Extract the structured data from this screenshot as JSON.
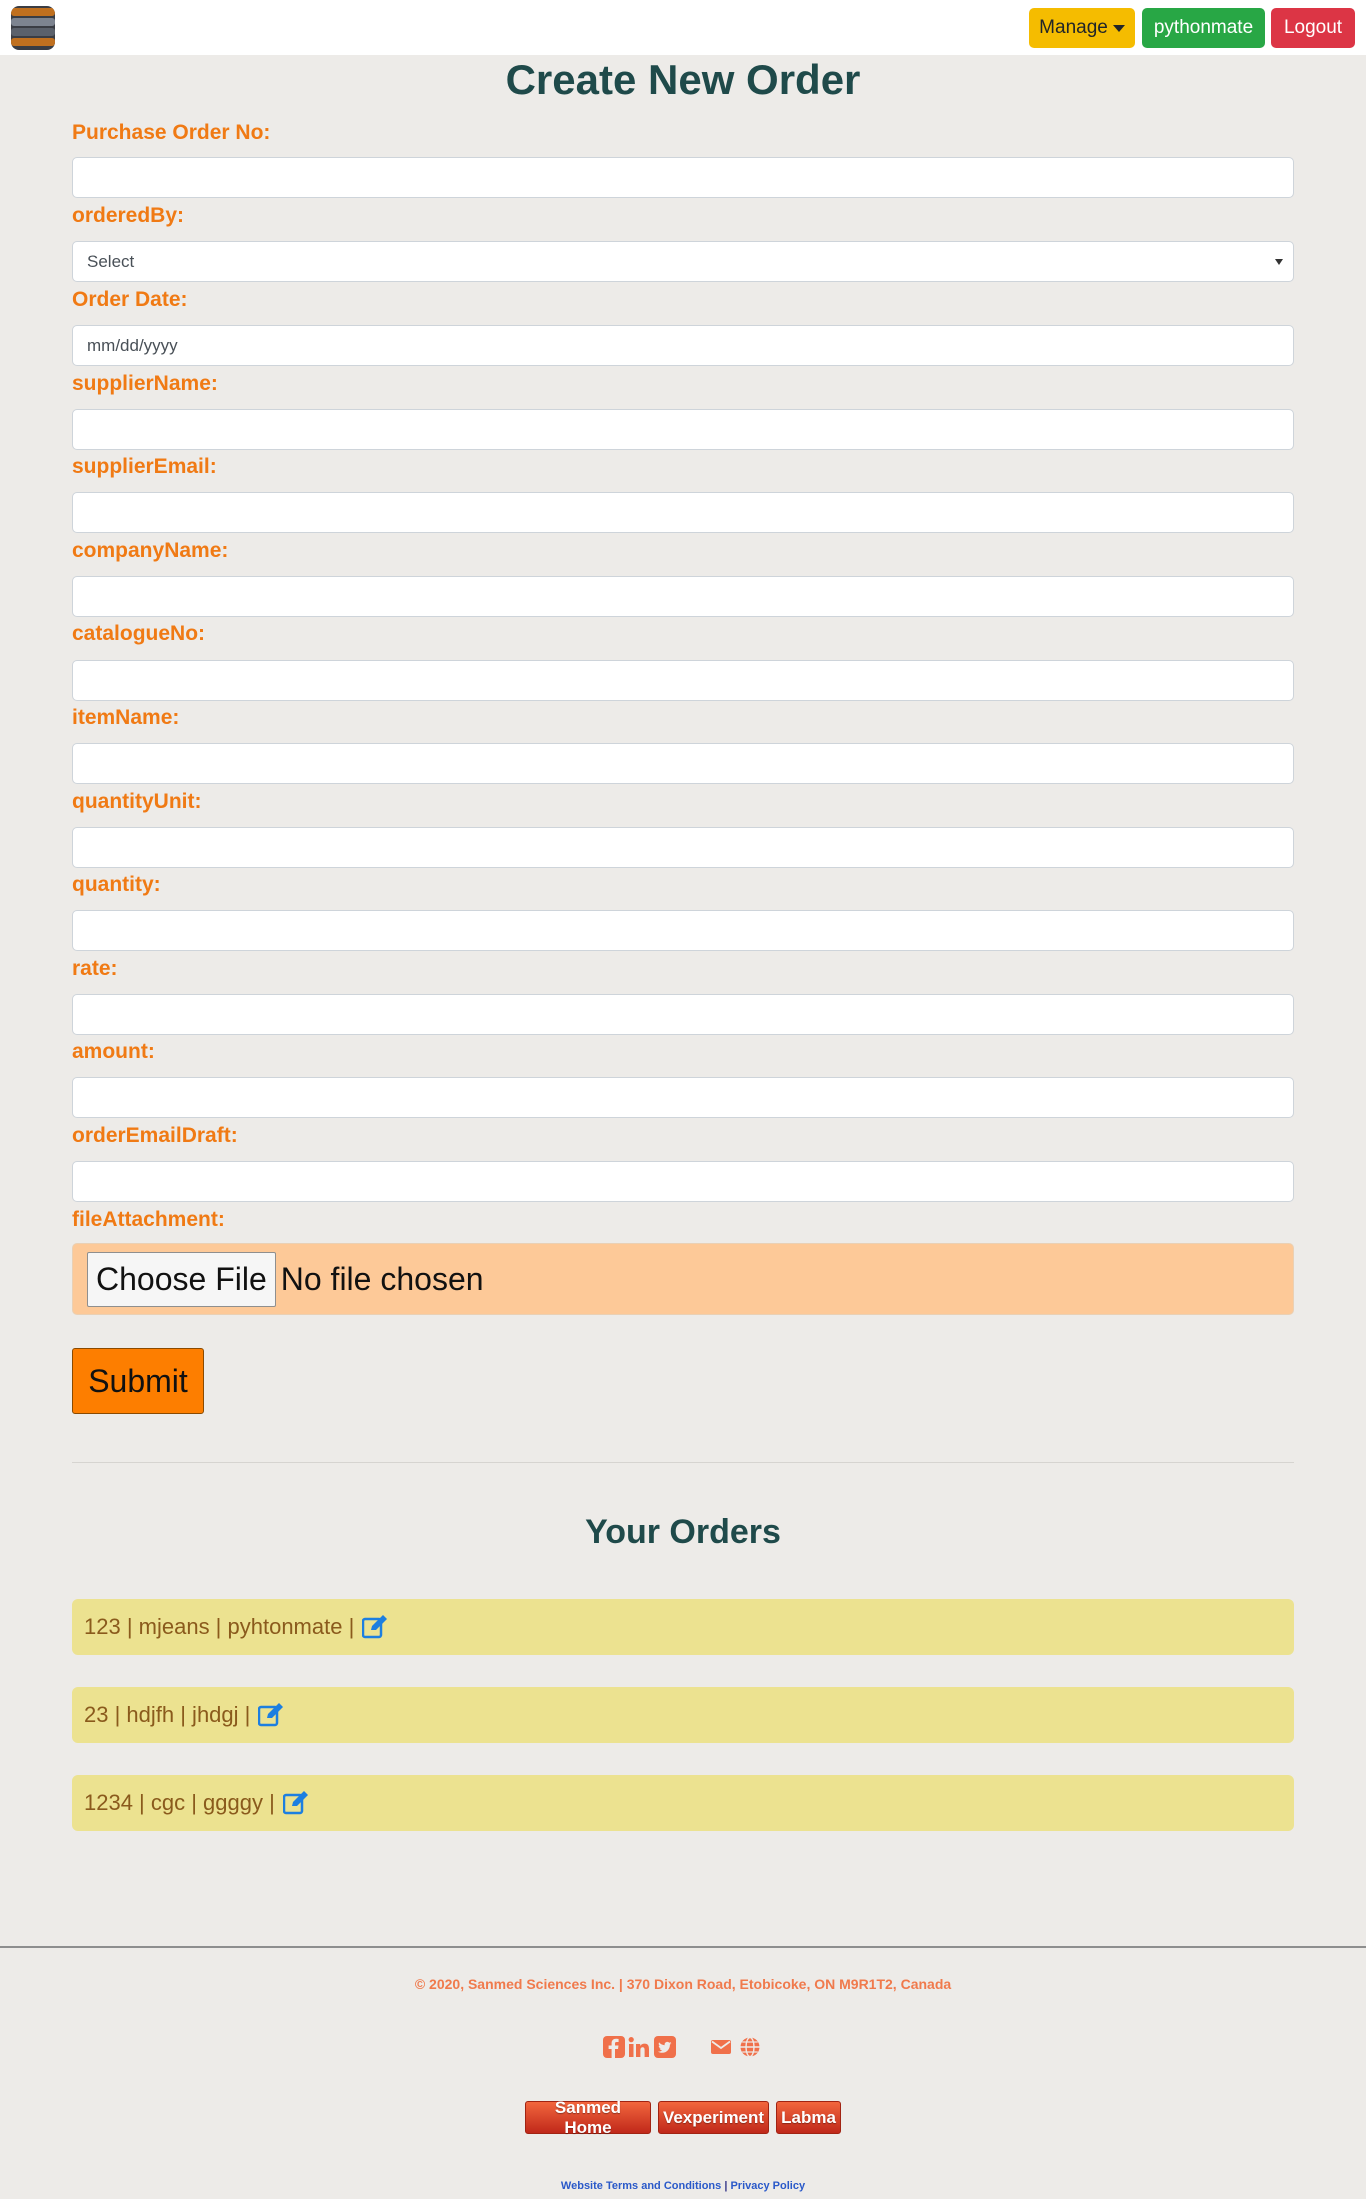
{
  "header": {
    "logo": "stacked-layers-logo",
    "manage_label": "Manage",
    "user_label": "pythonmate",
    "logout_label": "Logout",
    "colors": {
      "manage": "#f5bc00",
      "user": "#28a745",
      "logout": "#dc3545"
    }
  },
  "form": {
    "title": "Create New Order",
    "fields": {
      "purchase_order_no": {
        "label": "Purchase Order No:",
        "value": ""
      },
      "ordered_by": {
        "label": "orderedBy:",
        "value": "Select"
      },
      "order_date": {
        "label": "Order Date:",
        "placeholder": "mm/dd/yyyy"
      },
      "supplier_name": {
        "label": "supplierName:",
        "value": ""
      },
      "supplier_email": {
        "label": "supplierEmail:",
        "value": ""
      },
      "company_name": {
        "label": "companyName:",
        "value": ""
      },
      "catalogue_no": {
        "label": "catalogueNo:",
        "value": ""
      },
      "item_name": {
        "label": "itemName:",
        "value": ""
      },
      "quantity_unit": {
        "label": "quantityUnit:",
        "value": ""
      },
      "quantity": {
        "label": "quantity:",
        "value": ""
      },
      "rate": {
        "label": "rate:",
        "value": ""
      },
      "amount": {
        "label": "amount:",
        "value": ""
      },
      "order_email_draft": {
        "label": "orderEmailDraft:",
        "value": ""
      }
    },
    "file_attachment": {
      "label": "fileAttachment:",
      "button_label": "Choose File",
      "status": "No file chosen"
    },
    "submit_label": "Submit",
    "label_color": "#f07a14"
  },
  "orders": {
    "title": "Your Orders",
    "items": [
      {
        "text": "123 | mjeans | pyhtonmate |",
        "icon": "edit-icon"
      },
      {
        "text": "23 | hdjfh | jhdgj |",
        "icon": "edit-icon"
      },
      {
        "text": "1234 | cgc | ggggy |",
        "icon": "edit-icon"
      }
    ]
  },
  "footer": {
    "copyright": "© 2020, Sanmed Sciences Inc. | 370 Dixon Road, Etobicoke, ON M9R1T2, Canada",
    "social_icons": [
      "facebook-icon",
      "linkedin-icon",
      "twitter-icon",
      "email-icon",
      "globe-icon"
    ],
    "links": [
      "Sanmed Home",
      "Vexperiment",
      "Labma"
    ],
    "terms_label": "Website Terms and Conditions",
    "separator": "|",
    "privacy_label": "Privacy Policy"
  }
}
